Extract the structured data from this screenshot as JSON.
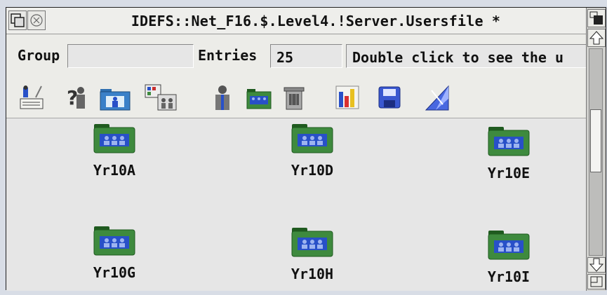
{
  "window": {
    "title": "IDEFS::Net_F16.$.Level4.!Server.Usersfile *"
  },
  "toolbar": {
    "group_label": "Group",
    "group_value": "",
    "entries_label": "Entries",
    "entries_value": "25",
    "status_text": "Double click to see the u",
    "tools": [
      "edit-user-icon",
      "user-query-icon",
      "open-folder-icon",
      "find-users-icon",
      "users-icon",
      "group-folder-icon",
      "trash-icon",
      "bar-chart-icon",
      "save-disk-icon",
      "sort-icon"
    ]
  },
  "groups": [
    {
      "name": "Yr10A"
    },
    {
      "name": "Yr10D"
    },
    {
      "name": "Yr10E"
    },
    {
      "name": "Yr10G"
    },
    {
      "name": "Yr10H"
    },
    {
      "name": "Yr10I"
    }
  ],
  "colors": {
    "folder_green": "#3e8a3e",
    "folder_dark": "#1f5a1f",
    "user_blue": "#2850c8",
    "window_grey": "#e3e3e0"
  }
}
